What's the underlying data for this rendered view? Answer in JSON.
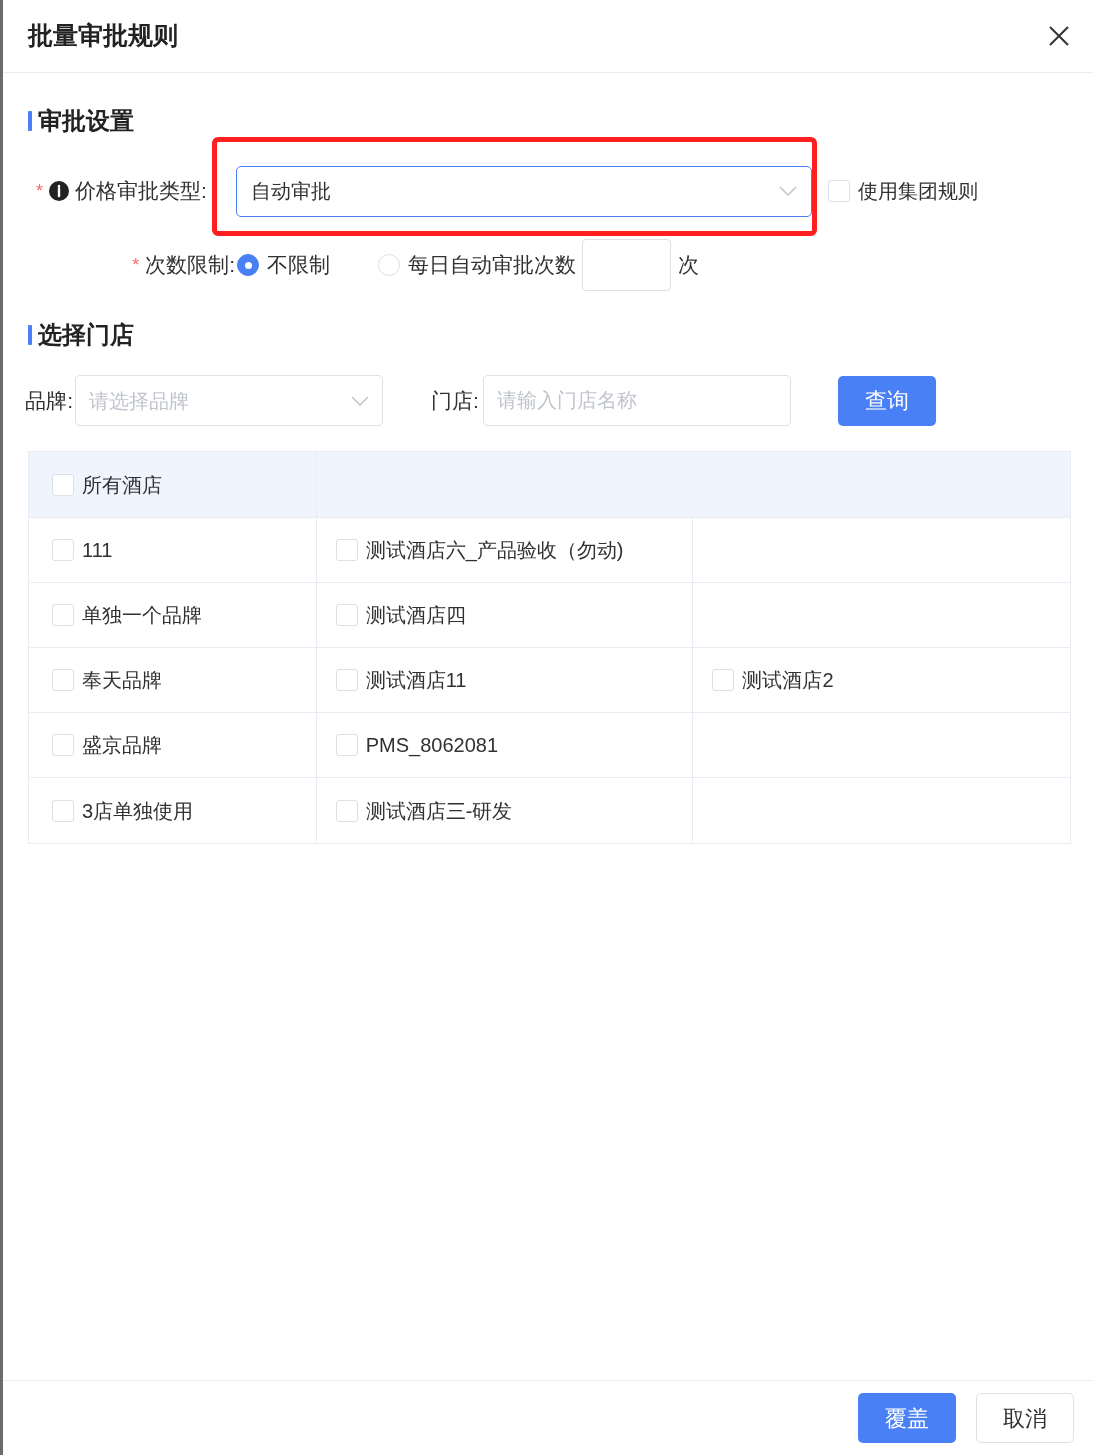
{
  "dialog": {
    "title": "批量审批规则"
  },
  "approval_section": {
    "title": "审批设置"
  },
  "approval_type": {
    "label": "价格审批类型:",
    "required_mark": "*",
    "value": "自动审批",
    "highlighted": true
  },
  "use_group_rule": {
    "label": "使用集团规则",
    "checked": false
  },
  "count_limit": {
    "label": "次数限制:",
    "required_mark": "*",
    "options": [
      {
        "kind": "plain",
        "label": "不限制",
        "selected": true
      },
      {
        "kind": "count",
        "label": "每日自动审批次数",
        "unit": "次",
        "selected": false
      }
    ]
  },
  "store_section": {
    "title": "选择门店"
  },
  "brand_filter": {
    "label": "品牌:",
    "placeholder": "请选择品牌"
  },
  "store_filter": {
    "label": "门店:",
    "placeholder": "请输入门店名称"
  },
  "query_button": "查询",
  "all_hotels": {
    "label": "所有酒店",
    "checked": false
  },
  "rows": [
    {
      "brand": {
        "label": "111",
        "checked": false
      },
      "stores": [
        {
          "label": "测试酒店六_产品验收（勿动)",
          "checked": false
        }
      ]
    },
    {
      "brand": {
        "label": "单独一个品牌",
        "checked": false
      },
      "stores": [
        {
          "label": "测试酒店四",
          "checked": false
        }
      ]
    },
    {
      "brand": {
        "label": "奉天品牌",
        "checked": false
      },
      "stores": [
        {
          "label": "测试酒店11",
          "checked": false
        },
        {
          "label": "测试酒店2",
          "checked": false
        }
      ]
    },
    {
      "brand": {
        "label": "盛京品牌",
        "checked": false
      },
      "stores": [
        {
          "label": "PMS_8062081",
          "checked": false
        }
      ]
    },
    {
      "brand": {
        "label": "3店单独使用",
        "checked": false
      },
      "stores": [
        {
          "label": "测试酒店三-研发",
          "checked": false
        }
      ]
    }
  ],
  "footer_buttons": [
    {
      "kind": "primary",
      "label": "覆盖"
    },
    {
      "kind": "default",
      "label": "取消"
    }
  ]
}
